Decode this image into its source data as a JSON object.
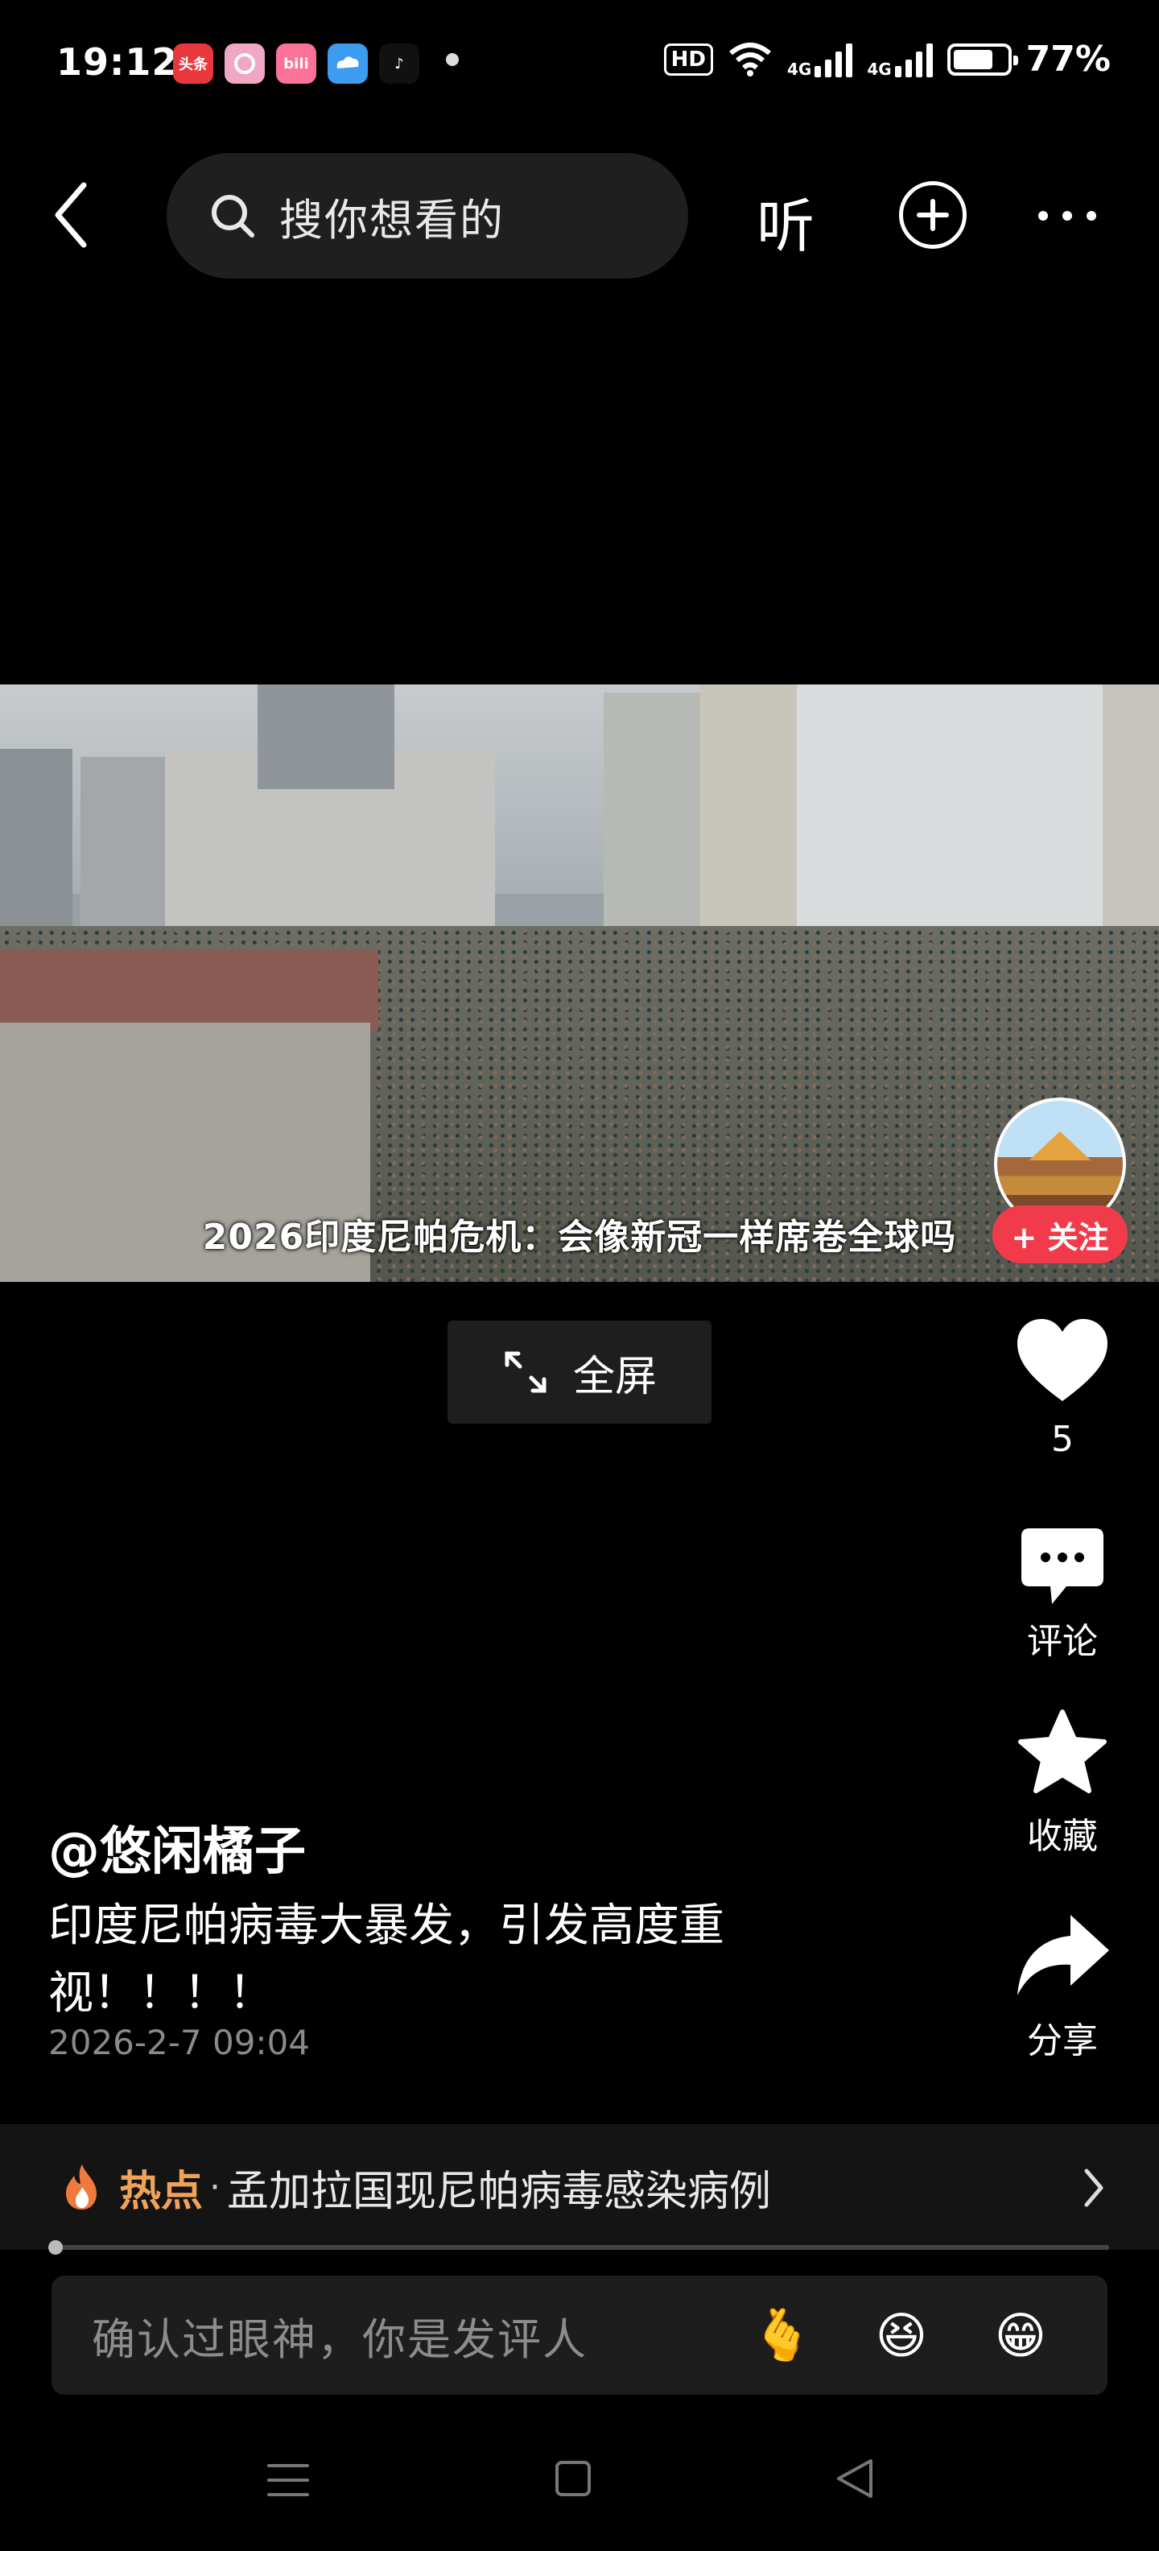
{
  "status_bar": {
    "time": "19:12",
    "app_icons": [
      {
        "label": "头条",
        "color": "#e8383d"
      },
      {
        "label": "",
        "color": "#f0a7c6"
      },
      {
        "label": "bili",
        "color": "#fb7299"
      },
      {
        "label": "",
        "color": "#3b9cf0"
      },
      {
        "label": "♪",
        "color": "#111111"
      }
    ],
    "hd": "HD",
    "net1": "4G",
    "net2": "4G",
    "battery": "77%"
  },
  "top_bar": {
    "search_placeholder": "搜你想看的",
    "listen_label": "听"
  },
  "video": {
    "subtitle": "2026印度尼帕危机：会像新冠一样席卷全球吗",
    "follow_label": "+ 关注",
    "fullscreen_label": "全屏"
  },
  "rail": {
    "like_count": "5",
    "comment_label": "评论",
    "favorite_label": "收藏",
    "share_label": "分享"
  },
  "post": {
    "author": "@悠闲橘子",
    "description": "印度尼帕病毒大暴发，引发高度重视！！！！",
    "date": "2026-2-7 09:04"
  },
  "hot": {
    "tag": "热点",
    "separator": "·",
    "text": "孟加拉国现尼帕病毒感染病例"
  },
  "comment_box": {
    "placeholder": "确认过眼神，你是发评人",
    "emojis": [
      "🫰",
      "😆",
      "😁"
    ]
  },
  "colors": {
    "accent_red": "#f23b4a",
    "hot_orange": "#f0a25a"
  }
}
